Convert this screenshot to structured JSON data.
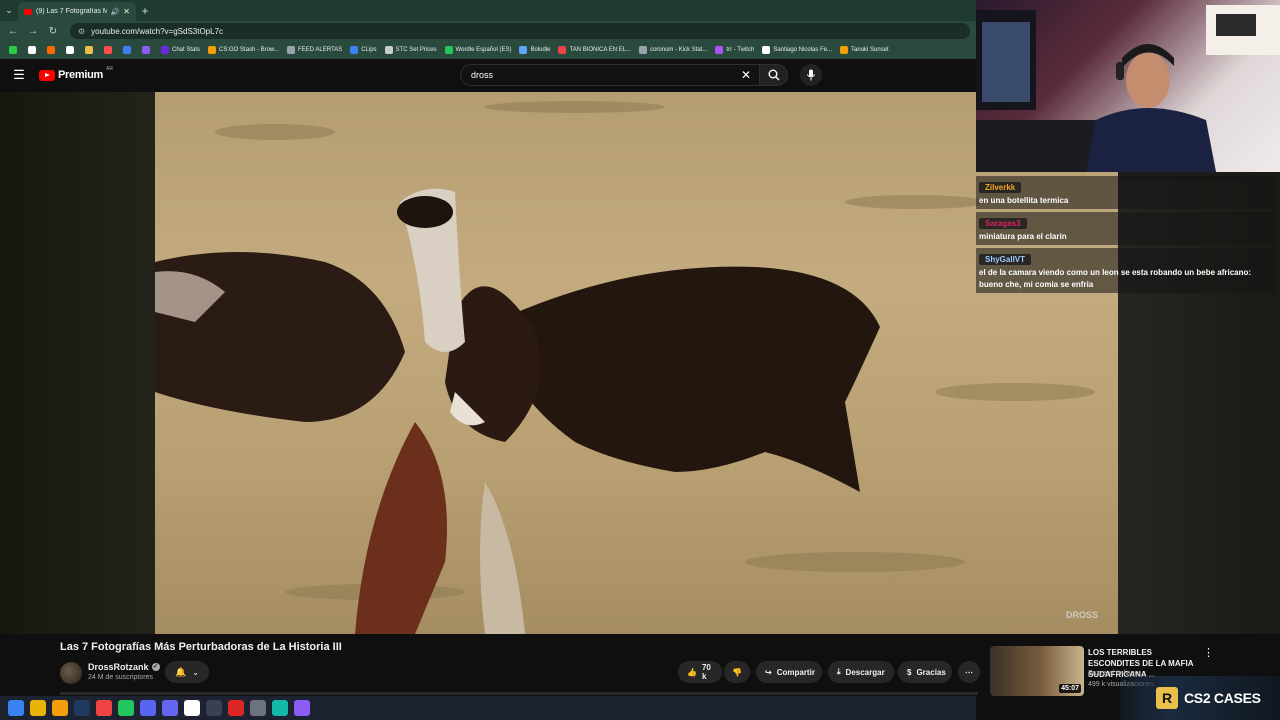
{
  "browser": {
    "tab_title": "(9) Las 7 Fotografías Más P...",
    "new_tab": "+",
    "url": "youtube.com/watch?v=gSdS3tOpL7c",
    "bookmarks": [
      {
        "label": "",
        "color": "#2ecc40"
      },
      {
        "label": "",
        "color": "#ffffff"
      },
      {
        "label": "",
        "color": "#ff6a00"
      },
      {
        "label": "",
        "color": "#ffffff"
      },
      {
        "label": "",
        "color": "#e8c04a"
      },
      {
        "label": "",
        "color": "#ff4d4d"
      },
      {
        "label": "",
        "color": "#3b82f6"
      },
      {
        "label": "",
        "color": "#8b5cf6"
      },
      {
        "label": "Chat Stats",
        "color": "#6d28d9"
      },
      {
        "label": "CS:GO Stash - Brow...",
        "color": "#f59e0b"
      },
      {
        "label": "FEED ALERTAS",
        "color": "#9ca3af"
      },
      {
        "label": "CLips",
        "color": "#3b82f6"
      },
      {
        "label": "STC Set Prices",
        "color": "#cccccc"
      },
      {
        "label": "Wordle Español (ES)",
        "color": "#22c55e"
      },
      {
        "label": "Boludle",
        "color": "#60a5fa"
      },
      {
        "label": "TAN BIONICA EN EL...",
        "color": "#ef4444"
      },
      {
        "label": "coronom - Kick Stat...",
        "color": "#9ca3af"
      },
      {
        "label": "trr - Twitch",
        "color": "#a855f7"
      },
      {
        "label": "Santiago Nicolas Fe...",
        "color": "#ffffff"
      },
      {
        "label": "Tanuki Sunset",
        "color": "#f59e0b"
      }
    ]
  },
  "youtube": {
    "logo_text": "Premium",
    "logo_region": "AR",
    "search_value": "dross"
  },
  "chat": [
    {
      "user": "Zilverkk",
      "user_color": "#f5a623",
      "text": "en una botellita termica"
    },
    {
      "user": "Saragas3",
      "user_color": "#e0245e",
      "text": "miniatura para el clarín"
    },
    {
      "user": "ShyGallVT",
      "user_color": "#9ecbff",
      "text": "el de la camara viendo como un leon se esta robando un bebe africano: bueno che, mi comia se enfria"
    }
  ],
  "video": {
    "title": "Las 7 Fotografías Más Perturbadoras de La Historia III",
    "channel": "DrossRotzank",
    "subscribers": "24 M de suscriptores",
    "watermark": "DROSS",
    "likes": "70 k",
    "share": "Compartir",
    "download": "Descargar",
    "thanks": "Gracias"
  },
  "recommended": {
    "title": "LOS TERRIBLES ESCONDITES DE LA MAFIA SUDAFRICANA ...",
    "channel": "Zazza el italiano",
    "views": "499 k visualizaciones",
    "duration": "45:07"
  },
  "banner": {
    "logo": "R",
    "text": "CS2 CASES"
  },
  "taskbar": [
    {
      "name": "windows",
      "color": "#3b82f6"
    },
    {
      "name": "chrome",
      "color": "#eab308"
    },
    {
      "name": "explorer",
      "color": "#f59e0b"
    },
    {
      "name": "steam",
      "color": "#1e3a5f"
    },
    {
      "name": "app-red",
      "color": "#ef4444"
    },
    {
      "name": "spotify",
      "color": "#22c55e"
    },
    {
      "name": "discord",
      "color": "#5865f2"
    },
    {
      "name": "app-blue",
      "color": "#6366f1"
    },
    {
      "name": "notion",
      "color": "#ffffff"
    },
    {
      "name": "app-dark",
      "color": "#374151"
    },
    {
      "name": "app-red2",
      "color": "#dc2626"
    },
    {
      "name": "app-gray",
      "color": "#6b7280"
    },
    {
      "name": "app-teal",
      "color": "#14b8a6"
    },
    {
      "name": "app-purple",
      "color": "#8b5cf6"
    }
  ]
}
